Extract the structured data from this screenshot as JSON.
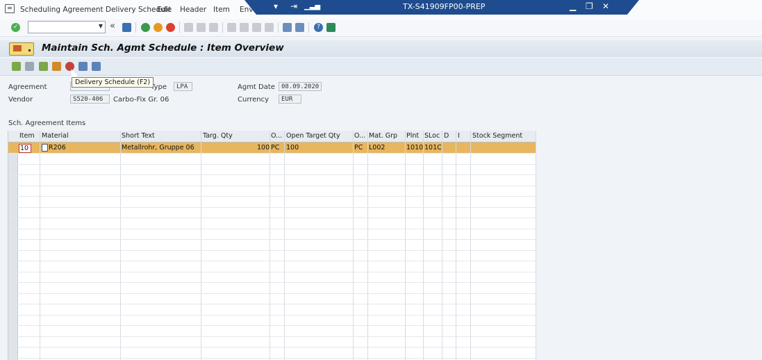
{
  "menu": {
    "items": [
      "Scheduling Agreement Delivery Schedule",
      "Edit",
      "Header",
      "Item",
      "Env"
    ]
  },
  "window": {
    "title": "TX-S41909FP00-PREP"
  },
  "page": {
    "title": "Maintain Sch. Agmt Schedule : Item Overview"
  },
  "tooltip": {
    "text": "Delivery Schedule  (F2)"
  },
  "header_fields": {
    "agreement_label": "Agreement",
    "agreement_type_label": "Type",
    "agreement_type_value": "LPA",
    "agmt_date_label": "Agmt Date",
    "agmt_date_value": "08.09.2020",
    "vendor_label": "Vendor",
    "vendor_value": "S520-406",
    "vendor_name": "Carbo-Fix Gr. 06",
    "currency_label": "Currency",
    "currency_value": "EUR"
  },
  "section": {
    "title": "Sch. Agreement Items"
  },
  "table": {
    "columns": [
      "Item",
      "Material",
      "Short Text",
      "Targ. Qty",
      "O...",
      "Open Target Qty",
      "O...",
      "Mat. Grp",
      "Plnt",
      "SLoc",
      "D",
      "I",
      "Stock Segment"
    ],
    "rows": [
      {
        "item": "10",
        "material": "R206",
        "short_text": "Metallrohr, Gruppe 06",
        "targ_qty": "100",
        "order_unit": "PC",
        "open_target_qty": "100",
        "open_unit": "PC",
        "mat_grp": "L002",
        "plnt": "1010",
        "sloc": "101C"
      }
    ]
  },
  "icons": {
    "ok": "check-icon",
    "save": "save-icon",
    "back": "back-icon",
    "exit": "exit-icon",
    "cancel": "cancel-icon",
    "help": "help-icon"
  },
  "colors": {
    "titlebar": "#1e4c8e",
    "selected_row": "#e8b65f",
    "background": "#f0f4f8"
  }
}
